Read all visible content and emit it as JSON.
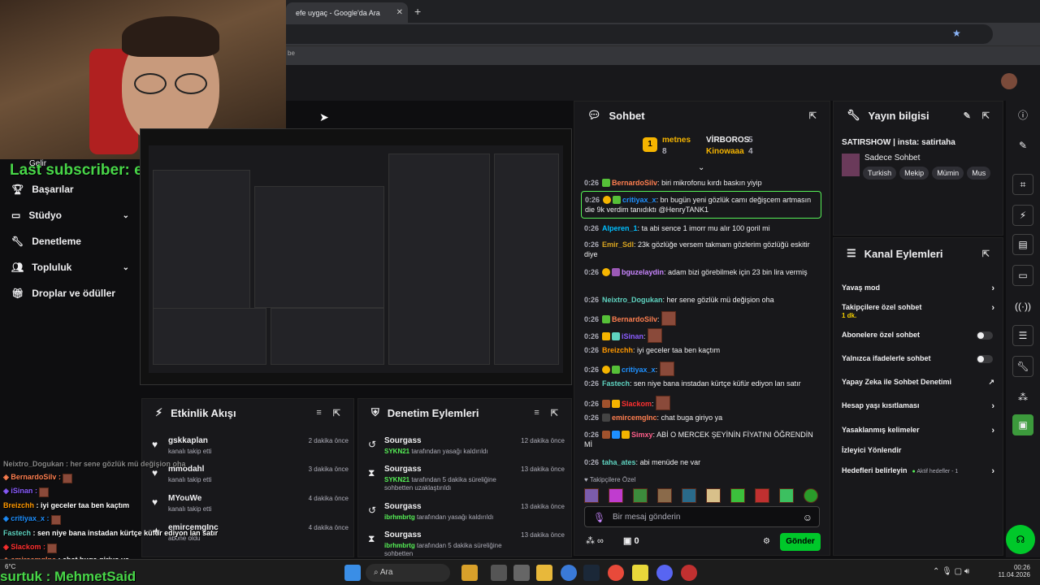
{
  "browser": {
    "tab_title": "efe uygaç - Google'da Ara",
    "close": "✕",
    "new_tab": "+",
    "bookmark_fragment": "be"
  },
  "overlay": {
    "last_subscriber": "Last subscriber: emircemgInc",
    "bottom_text": "surtuk : MehmetSaid",
    "weather": "6°C"
  },
  "left_nav": {
    "partial": "Gelir",
    "items": [
      {
        "label": "Başarılar",
        "icon": "trophy-icon",
        "chev": false
      },
      {
        "label": "Stüdyo",
        "icon": "tv-icon",
        "chev": true
      },
      {
        "label": "Denetleme",
        "icon": "wrench-icon",
        "chev": false
      },
      {
        "label": "Topluluk",
        "icon": "people-icon",
        "chev": true
      },
      {
        "label": "Droplar ve ödüller",
        "icon": "gift-icon",
        "chev": false
      }
    ]
  },
  "activity": {
    "title": "Etkinlik Akışı",
    "rows": [
      {
        "user": "gskkaplan",
        "sub": "kanalı takip etti",
        "time": "2 dakika önce"
      },
      {
        "user": "mmodahl",
        "sub": "kanalı takip etti",
        "time": "3 dakika önce"
      },
      {
        "user": "MYouWe",
        "sub": "kanalı takip etti",
        "time": "4 dakika önce"
      },
      {
        "user": "emircemgInc",
        "sub": "abone oldu",
        "time": "4 dakika önce"
      }
    ]
  },
  "moderation": {
    "title": "Denetim Eylemleri",
    "rows": [
      {
        "user": "Sourgass",
        "mod": "SYKN21",
        "sub": "tarafından yasağı kaldırıldı",
        "time": "12 dakika önce",
        "icon": "undo-icon"
      },
      {
        "user": "Sourgass",
        "mod": "SYKN21",
        "sub": "tarafından 5 dakika süreliğine sohbetten uzaklaştırıldı",
        "time": "13 dakika önce",
        "icon": "hourglass-icon"
      },
      {
        "user": "Sourgass",
        "mod": "ibrhmbrtg",
        "sub": "tarafından yasağı kaldırıldı",
        "time": "13 dakika önce",
        "icon": "undo-icon"
      },
      {
        "user": "Sourgass",
        "mod": "ibrhmbrtg",
        "sub": "tarafından 5 dakika süreliğine sohbetten",
        "time": "13 dakika önce",
        "icon": "hourglass-icon"
      }
    ]
  },
  "chat": {
    "title": "Sohbet",
    "leaders": [
      {
        "rank": "1",
        "name": "metnes",
        "count": "8"
      },
      {
        "rank": "",
        "name": "VİRBOROS",
        "count": "5"
      },
      {
        "rank": "",
        "name": "Kinowaaa",
        "count": "4"
      }
    ],
    "messages": [
      {
        "time": "0:26",
        "user": "BernardoSilv",
        "color": "#ff7f50",
        "text": "biri mikrofonu kırdı baskın yiyip"
      },
      {
        "time": "0:26",
        "user": "critiyax_x",
        "color": "#1e90ff",
        "text": "bn bugün yeni gözlük camı değişcem artmasın die 9k verdim tanıdıktı @HenryTANK1"
      },
      {
        "time": "0:26",
        "user": "Alperen_1",
        "color": "#00bfff",
        "text": "ta abi sence 1 imorr mu alır 100 goril mi"
      },
      {
        "time": "0:26",
        "user": "Emir_Sdl",
        "color": "#daa520",
        "text": "23k gözlüğe versem takmam gözlerim gözlüğü eskitir diye"
      },
      {
        "time": "0:26",
        "user": "bguzelaydin",
        "color": "#c986ff",
        "text": "adam bizi görebilmek için 23 bin lira vermiş"
      },
      {
        "time": "0:26",
        "user": "Neixtro_Dogukan",
        "color": "#5fd3c0",
        "text": "her sene gözlük mü değişion oha"
      },
      {
        "time": "0:26",
        "user": "BernardoSilv",
        "color": "#ff7f50",
        "text": ""
      },
      {
        "time": "0:26",
        "user": "iSinan",
        "color": "#8a5cff",
        "text": ""
      },
      {
        "time": "0:26",
        "user": "Breizchh",
        "color": "#ff9800",
        "text": "iyi geceler taa ben kaçtım"
      },
      {
        "time": "0:26",
        "user": "critiyax_x",
        "color": "#1e90ff",
        "text": ""
      },
      {
        "time": "0:26",
        "user": "Fastech",
        "color": "#5fd3c0",
        "text": "sen niye bana instadan kürtçe küfür ediyon lan satır"
      },
      {
        "time": "0:26",
        "user": "Slackom",
        "color": "#ff3030",
        "text": ""
      },
      {
        "time": "0:26",
        "user": "emircemgInc",
        "color": "#ff7f50",
        "text": "chat buga giriyo ya"
      },
      {
        "time": "0:26",
        "user": "Simxy",
        "color": "#ff5e8a",
        "text": "ABİ O MERCEK ŞEYİNİN FİYATINI ÖĞRENDİN Mİ"
      },
      {
        "time": "0:26",
        "user": "taha_ates",
        "color": "#5fd3c0",
        "text": "abi menüde ne var"
      }
    ],
    "followers_only": "Takipçilere Özel",
    "placeholder": "Bir mesaj gönderin",
    "points": "0",
    "send": "Gönder"
  },
  "stream_info": {
    "title": "Yayın bilgisi",
    "stream_title": "SATIRSHOW | insta: satirtaha",
    "category": "Sadece Sohbet",
    "tags": [
      "Turkish",
      "Mekip",
      "Mümin",
      "Mus"
    ]
  },
  "channel_actions": {
    "title": "Kanal Eylemleri",
    "rows": [
      {
        "label": "Yavaş mod",
        "type": "chev"
      },
      {
        "label": "Takipçilere özel sohbet",
        "sub": "1 dk.",
        "type": "chev"
      },
      {
        "label": "Abonelere özel sohbet",
        "type": "toggle"
      },
      {
        "label": "Yalnızca ifadelerle sohbet",
        "type": "toggle"
      },
      {
        "label": "Yapay Zeka ile Sohbet Denetimi",
        "type": "ext"
      },
      {
        "label": "Hesap yaşı kısıtlaması",
        "type": "chev"
      },
      {
        "label": "Yasaklanmış kelimeler",
        "type": "chev"
      },
      {
        "label": "İzleyici Yönlendir",
        "type": "none"
      },
      {
        "label": "Hedefleri belirleyin",
        "sub": "Aktif hedefler - 1",
        "type": "chev"
      }
    ]
  },
  "side_chat": [
    {
      "user": "Neixtro_Dogukan",
      "text": "her sene gözlük mü değişion oha",
      "color": "#5fd3c0"
    },
    {
      "user": "BernardoSilv",
      "text": "",
      "color": "#ff7f50"
    },
    {
      "user": "iSinan",
      "text": "",
      "color": "#8a5cff"
    },
    {
      "user": "Breizchh",
      "text": "iyi geceler taa ben kaçtım",
      "color": "#ff9800"
    },
    {
      "user": "critiyax_x",
      "text": "",
      "color": "#1e90ff"
    },
    {
      "user": "Fastech",
      "text": "sen niye bana instadan kürtçe küfür ediyon lan satır",
      "color": "#5fd3c0"
    },
    {
      "user": "Slackom",
      "text": "",
      "color": "#ff3030"
    },
    {
      "user": "emircemgInc",
      "text": "chat buga giriyo ya",
      "color": "#ff7f50"
    }
  ],
  "taskbar": {
    "search": "Ara",
    "time": "00:26",
    "date": "11.04.2026"
  }
}
